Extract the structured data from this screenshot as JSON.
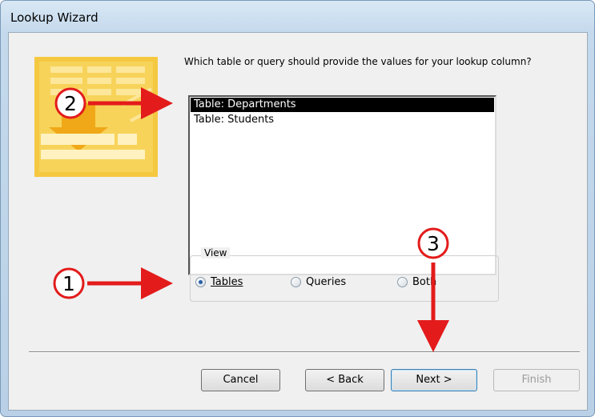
{
  "window": {
    "title": "Lookup Wizard"
  },
  "prompt": "Which table or query should provide the values for your lookup column?",
  "list": {
    "items": [
      {
        "label": "Table: Departments",
        "selected": true
      },
      {
        "label": "Table: Students",
        "selected": false
      }
    ]
  },
  "view": {
    "legend": "View",
    "options": [
      {
        "label": "Tables",
        "checked": true
      },
      {
        "label": "Queries",
        "checked": false
      },
      {
        "label": "Both",
        "checked": false
      }
    ]
  },
  "buttons": {
    "cancel": "Cancel",
    "back": "< Back",
    "next": "Next >",
    "finish": "Finish"
  },
  "callouts": {
    "one": "1",
    "two": "2",
    "three": "3"
  },
  "colors": {
    "accent": "#e31b1b",
    "selection": "#000000",
    "wizard_art": "#f5c842"
  }
}
